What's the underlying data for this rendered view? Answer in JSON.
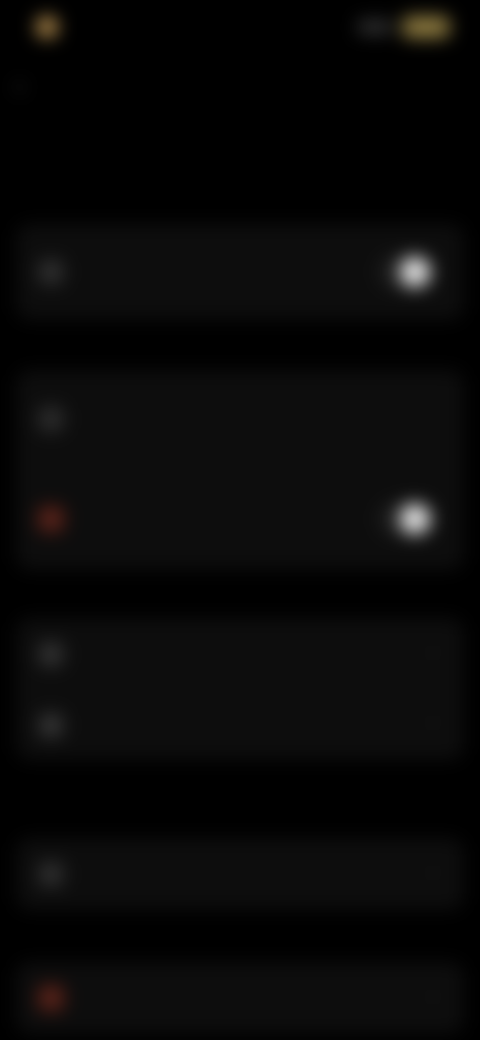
{
  "status_bar": {
    "time": "",
    "signal": ""
  },
  "header": {
    "back_icon": "chevron-left-icon",
    "title": ""
  },
  "sections": {
    "first": {
      "header": ""
    },
    "second": {
      "header": ""
    },
    "third": {
      "header": ""
    },
    "fourth": {
      "header": ""
    },
    "fifth": {
      "header": ""
    }
  },
  "rows": {
    "toggle_one": {
      "title": "",
      "subtitle": "",
      "icon": "gear-icon",
      "on": true
    },
    "item_one": {
      "title": "",
      "subtitle": "",
      "icon": "info-icon"
    },
    "toggle_two": {
      "title": "",
      "subtitle": "",
      "icon": "bell-icon",
      "on": true
    },
    "item_two": {
      "title": "",
      "icon": "document-icon"
    },
    "item_three": {
      "title": "",
      "icon": "lock-icon"
    },
    "item_four": {
      "title": "",
      "icon": "user-icon"
    },
    "danger_item": {
      "title": "",
      "icon": "trash-icon"
    }
  },
  "colors": {
    "background": "#000000",
    "card": "#0d0d0d",
    "accent_battery": "#8d7a40",
    "danger": "#7a2a22"
  }
}
